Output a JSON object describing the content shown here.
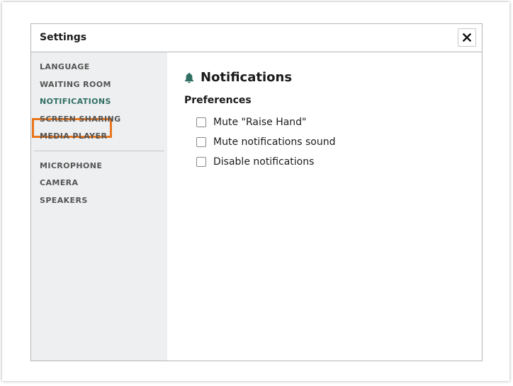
{
  "dialog": {
    "title": "Settings",
    "close_icon": "close-icon"
  },
  "sidebar": {
    "groups": [
      {
        "items": [
          {
            "label": "LANGUAGE"
          },
          {
            "label": "WAITING ROOM"
          },
          {
            "label": "NOTIFICATIONS",
            "active": true
          },
          {
            "label": "SCREEN SHARING"
          },
          {
            "label": "MEDIA PLAYER"
          }
        ]
      },
      {
        "items": [
          {
            "label": "MICROPHONE"
          },
          {
            "label": "CAMERA"
          },
          {
            "label": "SPEAKERS"
          }
        ]
      }
    ]
  },
  "main": {
    "icon": "bell-icon",
    "title": "Notifications",
    "preferences_heading": "Preferences",
    "options": [
      {
        "label": "Mute \"Raise Hand\"",
        "checked": false
      },
      {
        "label": "Mute notifications sound",
        "checked": false
      },
      {
        "label": "Disable notifications",
        "checked": false
      }
    ]
  },
  "colors": {
    "accent": "#2f6e63",
    "focus_outline": "#e8761e",
    "sidebar_bg": "#eeeff0"
  }
}
